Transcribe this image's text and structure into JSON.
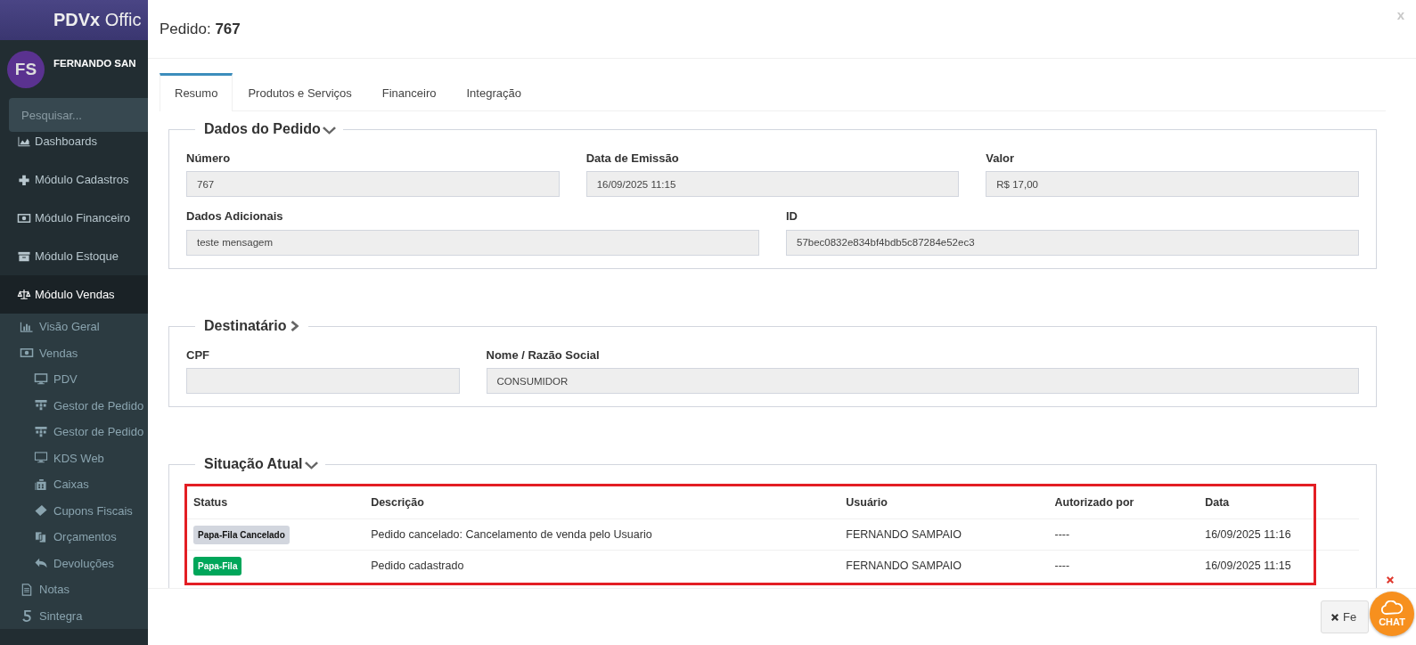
{
  "sidebar": {
    "brand": "**PDVx** Offic",
    "user": {
      "initials": "FS",
      "name": "FERNANDO SAN"
    },
    "search": {
      "placeholder": "Pesquisar..."
    },
    "items": [
      {
        "label": "Dashboards",
        "selected": false
      },
      {
        "label": "Módulo Cadastros",
        "selected": false
      },
      {
        "label": "Módulo Financeiro",
        "selected": false
      },
      {
        "label": "Módulo Estoque",
        "selected": false
      },
      {
        "label": "Módulo Vendas",
        "selected": true,
        "expanded": true,
        "children": [
          {
            "label": "Visão Geral"
          },
          {
            "label": "Vendas",
            "expanded": true,
            "children": [
              {
                "label": "PDV"
              },
              {
                "label": "Gestor de Pedido"
              },
              {
                "label": "Gestor de Pedido"
              },
              {
                "label": "KDS Web"
              },
              {
                "label": "Caixas"
              },
              {
                "label": "Cupons Fiscais"
              },
              {
                "label": "Orçamentos"
              },
              {
                "label": "Devoluções"
              }
            ]
          },
          {
            "label": "Notas"
          },
          {
            "label": "Sintegra"
          }
        ]
      }
    ]
  },
  "modal": {
    "title": "Pedido: **767**",
    "close": "x",
    "tabs": [
      {
        "label": "Resumo",
        "selected": true
      },
      {
        "label": "Produtos e Serviços",
        "selected": false
      },
      {
        "label": "Financeiro",
        "selected": false
      },
      {
        "label": "Integração",
        "selected": false
      }
    ],
    "sections": [
      {
        "kind": "fields",
        "title": "Dados do Pedido",
        "expanded": true,
        "rows": [
          [
            {
              "label": "Número",
              "value": "767"
            },
            {
              "label": "Data de Emissão",
              "value": "16/09/2025 11:15"
            },
            {
              "label": "Valor",
              "value": "R$ 17,00"
            }
          ],
          [
            {
              "label": "Dados Adicionais",
              "value": "teste mensagem"
            },
            {
              "label": "ID",
              "value": "57bec0832e834bf4bdb5c87284e52ec3"
            }
          ]
        ]
      },
      {
        "kind": "fields",
        "title": "Destinatário",
        "expanded": false,
        "rows": [
          [
            {
              "label": "CPF"
            },
            {
              "label": "Nome / Razão Social",
              "value": "CONSUMIDOR"
            }
          ]
        ]
      },
      {
        "kind": "table",
        "title": "Situação Atual",
        "expanded": true,
        "columns": [
          "Status",
          "Descrição",
          "Usuário",
          "Autorizado por",
          "Data"
        ],
        "rows": [
          {
            "cells": [
              {
                "text": "Papa-Fila Cancelado",
                "color": "#d2d6de"
              },
              {
                "text": "Pedido cancelado: Cancelamento de venda pelo Usuario"
              },
              {
                "text": "FERNANDO SAMPAIO"
              },
              {
                "text": "----"
              },
              {
                "text": "16/09/2025 11:16"
              }
            ]
          },
          {
            "cells": [
              {
                "text": "Papa-Fila",
                "color": "#00a65a"
              },
              {
                "text": "Pedido cadastrado"
              },
              {
                "text": "FERNANDO SAMPAIO"
              },
              {
                "text": "----"
              },
              {
                "text": "16/09/2025 11:15"
              }
            ]
          }
        ]
      }
    ],
    "footer_button": "Fe"
  },
  "chat": {
    "label": "CHAT"
  }
}
